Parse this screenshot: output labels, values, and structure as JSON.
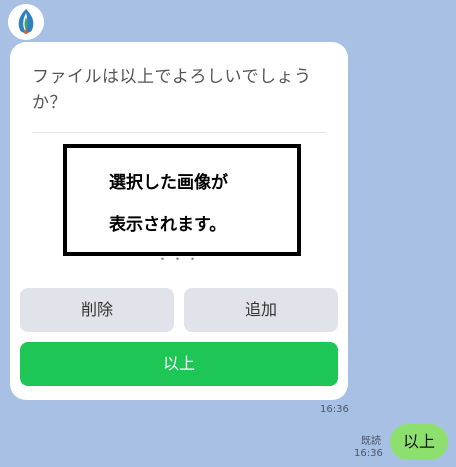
{
  "card": {
    "question": "ファイルは以上でよろしいでしょうか？",
    "image_text_line1": "選択した画像が",
    "image_text_line2": "表示されます。",
    "dots": "・・・",
    "buttons": {
      "delete": "削除",
      "add": "追加",
      "ok": "以上"
    }
  },
  "received_time": "16:36",
  "sent": {
    "read_label": "既読",
    "time": "16:36",
    "message": "以上"
  },
  "colors": {
    "background": "#a8c0e4",
    "ok_button": "#1ec655",
    "secondary_button": "#e0e3ea",
    "sent_bubble": "#8de06e"
  },
  "icons": {
    "avatar": "leaf-drop-logo-icon"
  }
}
